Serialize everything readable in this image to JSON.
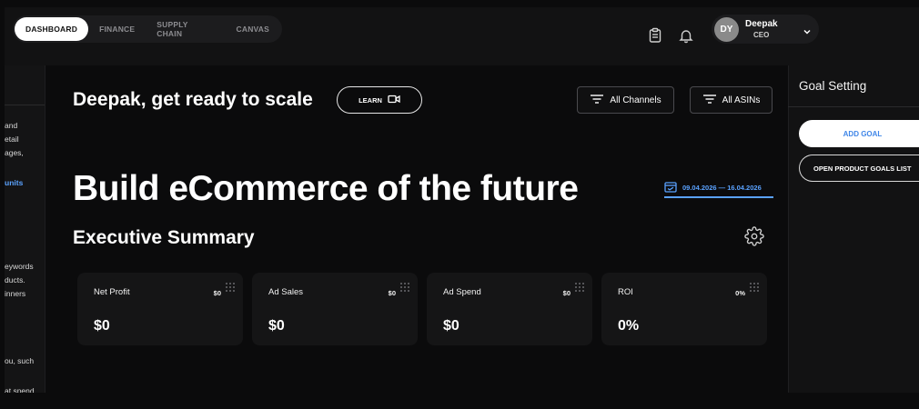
{
  "tabs": [
    {
      "label": "DASHBOARD",
      "active": true
    },
    {
      "label": "FINANCE",
      "active": false
    },
    {
      "label": "SUPPLY CHAIN",
      "active": false
    },
    {
      "label": "CANVAS",
      "active": false
    }
  ],
  "header_icons": [
    "clipboard-icon",
    "bell-icon"
  ],
  "user": {
    "initials": "DY",
    "name": "Deepak",
    "role": "CEO"
  },
  "left_panel_fragments": [
    "and",
    "etail",
    "ages,",
    "units",
    "eywords",
    "ducts.",
    "inners",
    "ou, such",
    "at spend"
  ],
  "main": {
    "greeting": "Deepak, get ready to scale",
    "learn_label": "LEARN",
    "filters": {
      "channels": "All Channels",
      "asins": "All ASINs"
    },
    "hero": "Build eCommerce of the future",
    "date_range": "09.04.2026 — 16.04.2026",
    "section_title": "Executive Summary"
  },
  "cards": [
    {
      "title": "Net Profit",
      "small": "$0",
      "value": "$0"
    },
    {
      "title": "Ad Sales",
      "small": "$0",
      "value": "$0"
    },
    {
      "title": "Ad Spend",
      "small": "$0",
      "value": "$0"
    },
    {
      "title": "ROI",
      "small": "0%",
      "value": "0%"
    }
  ],
  "goal_panel": {
    "title": "Goal Setting",
    "add_goal": "ADD GOAL",
    "open_list": "OPEN PRODUCT GOALS LIST"
  },
  "colors": {
    "accent_blue": "#5aa2ff",
    "background": "#0b0b0c",
    "panel": "#121213",
    "card": "#151516"
  }
}
